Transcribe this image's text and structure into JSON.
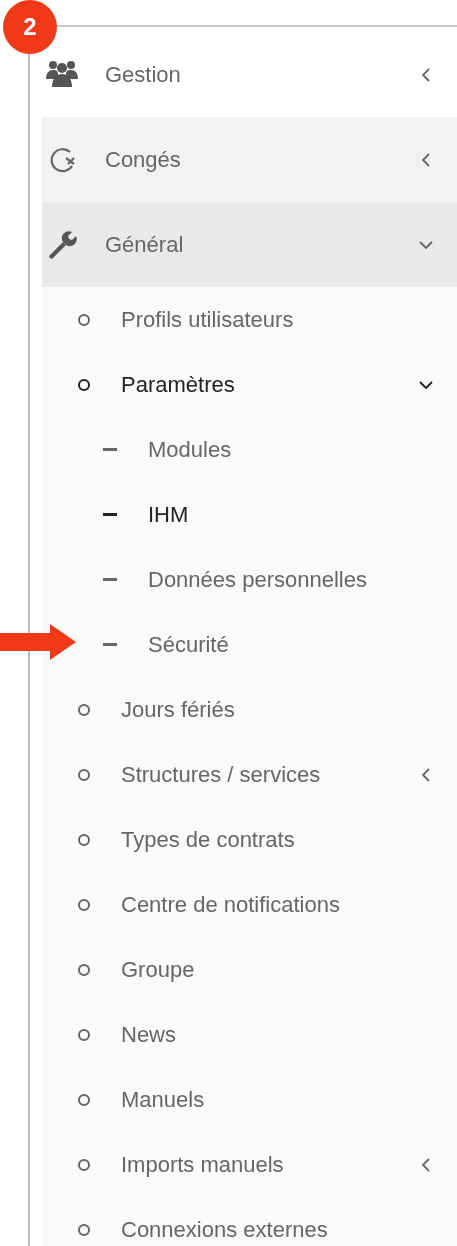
{
  "step_badge": "2",
  "menu": [
    {
      "label": "Gestion",
      "expanded": false,
      "hovered": false
    },
    {
      "label": "Congés",
      "expanded": false,
      "hovered": true
    },
    {
      "label": "Général",
      "expanded": true,
      "hovered": false,
      "children": [
        {
          "label": "Profils utilisateurs",
          "selected": false
        },
        {
          "label": "Paramètres",
          "selected": true,
          "expanded": true,
          "children": [
            {
              "label": "Modules",
              "selected": false,
              "pointed": false
            },
            {
              "label": "IHM",
              "selected": true,
              "pointed": false
            },
            {
              "label": "Données personnelles",
              "selected": false,
              "pointed": false
            },
            {
              "label": "Sécurité",
              "selected": false,
              "pointed": true
            }
          ]
        },
        {
          "label": "Jours fériés",
          "selected": false
        },
        {
          "label": "Structures / services",
          "selected": false,
          "expanded": false
        },
        {
          "label": "Types de contrats",
          "selected": false
        },
        {
          "label": "Centre de notifications",
          "selected": false
        },
        {
          "label": "Groupe",
          "selected": false
        },
        {
          "label": "News",
          "selected": false
        },
        {
          "label": "Manuels",
          "selected": false
        },
        {
          "label": "Imports manuels",
          "selected": false,
          "expanded": false
        },
        {
          "label": "Connexions externes",
          "selected": false
        }
      ]
    }
  ]
}
